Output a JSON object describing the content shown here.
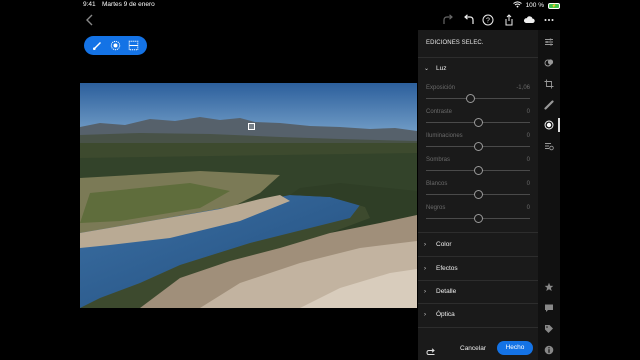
{
  "status": {
    "time": "9:41",
    "date": "Martes 9 de enero",
    "battery": "100 %"
  },
  "toolbar": {
    "icons": [
      "back-chevron-icon",
      "redo-icon",
      "undo-icon",
      "help-icon",
      "share-icon",
      "cloud-sync-icon",
      "more-icon"
    ]
  },
  "canvas": {
    "tools": [
      "brush-icon",
      "radial-gradient-icon",
      "linear-gradient-icon"
    ]
  },
  "panel": {
    "title": "EDICIONES SELEC.",
    "light": {
      "label": "Luz",
      "sliders": [
        {
          "label": "Exposición",
          "value": "-1,06",
          "position": 0.43
        },
        {
          "label": "Contraste",
          "value": "0",
          "position": 0.5
        },
        {
          "label": "Iluminaciones",
          "value": "0",
          "position": 0.5
        },
        {
          "label": "Sombras",
          "value": "0",
          "position": 0.5
        },
        {
          "label": "Blancos",
          "value": "0",
          "position": 0.5
        },
        {
          "label": "Negros",
          "value": "0",
          "position": 0.5
        }
      ]
    },
    "sections": [
      "Color",
      "Efectos",
      "Detalle",
      "Óptica"
    ]
  },
  "bottom": {
    "cancel": "Cancelar",
    "done": "Hecho"
  },
  "rail": {
    "top_icons": [
      "sliders-icon",
      "presets-icon",
      "crop-icon",
      "healing-icon",
      "masking-icon",
      "versions-icon"
    ],
    "bottom_icons": [
      "star-icon",
      "comment-icon",
      "tag-icon",
      "info-icon"
    ]
  },
  "colors": {
    "accent": "#1473e6",
    "panel": "#1a1a1a"
  }
}
